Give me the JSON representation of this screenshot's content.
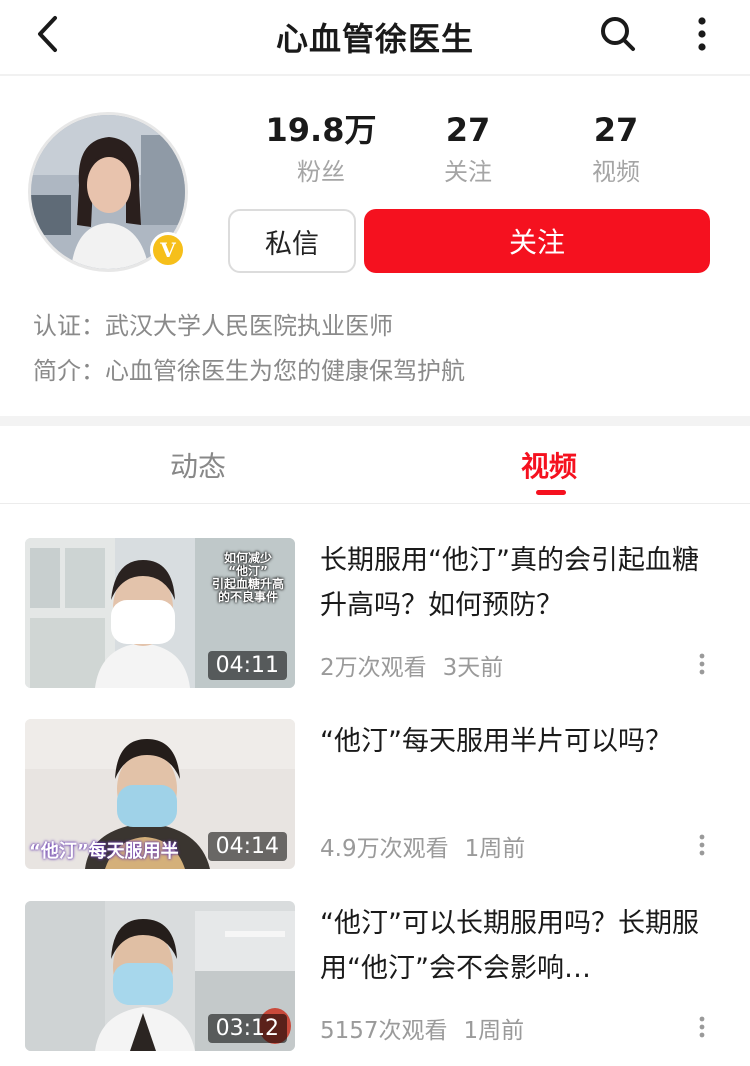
{
  "header": {
    "title": "心血管徐医生",
    "icons": [
      "chevron-left-icon",
      "search-icon",
      "more-vertical-icon"
    ]
  },
  "profile": {
    "verified_badge": "V",
    "stats": [
      {
        "value": "19.8万",
        "label": "粉丝"
      },
      {
        "value": "27",
        "label": "关注"
      },
      {
        "value": "27",
        "label": "视频"
      }
    ],
    "message_label": "私信",
    "follow_label": "关注",
    "certification_label": "认证：",
    "certification_value": "武汉大学人民医院执业医师",
    "bio_label": "简介：",
    "bio_value": "心血管徐医生为您的健康保驾护航"
  },
  "tabs": [
    {
      "label": "动态",
      "active": false
    },
    {
      "label": "视频",
      "active": true
    }
  ],
  "videos": [
    {
      "title": "长期服用“他汀”真的会引起血糖升高吗？如何预防？",
      "duration": "04:11",
      "views": "2万次观看",
      "time": "3天前",
      "thumb_caption": "如何减少\n“他汀”\n引起血糖升高\n的不良事件"
    },
    {
      "title": "“他汀”每天服用半片可以吗？",
      "duration": "04:14",
      "views": "4.9万次观看",
      "time": "1周前",
      "thumb_caption": "“他汀”每天服用半"
    },
    {
      "title": "“他汀”可以长期服用吗？长期服用“他汀”会不会影响…",
      "duration": "03:12",
      "views": "5157次观看",
      "time": "1周前"
    }
  ],
  "colors": {
    "accent": "#f5111f",
    "badge": "#f6bf1a",
    "muted_text": "#8a8a8a"
  }
}
